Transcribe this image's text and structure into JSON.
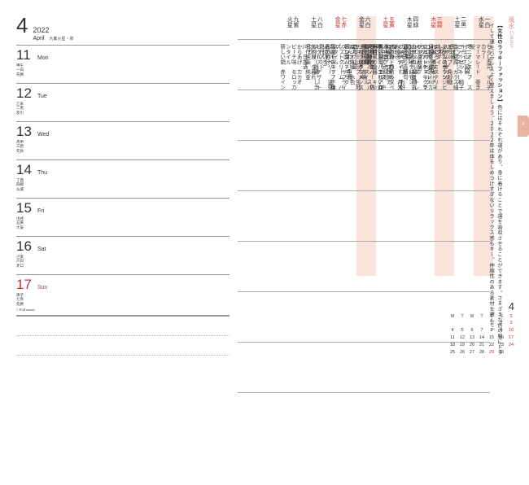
{
  "header": {
    "monthNum": "4",
    "year": "2022",
    "monthEn": "April",
    "monthJp": "九紫火星・卯"
  },
  "days": [
    {
      "num": "11",
      "dow": "Mon",
      "sub": "甲午\n一白\n先勝",
      "sun": false,
      "moon": ""
    },
    {
      "num": "12",
      "dow": "Tue",
      "sub": "乙未\n二黒\n友引",
      "sun": false,
      "moon": ""
    },
    {
      "num": "13",
      "dow": "Wed",
      "sub": "丙申\n三碧\n先負",
      "sun": false,
      "moon": ""
    },
    {
      "num": "14",
      "dow": "Thu",
      "sub": "丁酉\n四緑\n仏滅",
      "sun": false,
      "moon": ""
    },
    {
      "num": "15",
      "dow": "Fri",
      "sub": "戊戌\n五黄\n大安",
      "sun": false,
      "moon": ""
    },
    {
      "num": "16",
      "dow": "Sat",
      "sub": "己亥\n六白\n赤口",
      "sun": false,
      "moon": ""
    },
    {
      "num": "17",
      "dow": "Sun",
      "sub": "庚子\n七赤\n先勝",
      "sun": true,
      "moon": "○ Full moon"
    }
  ],
  "fusui": {
    "title": "風水",
    "sub": "Column"
  },
  "tab": "4",
  "columnText": {
    "bold": "【女性のラッキーファッション】",
    "rest": "色にはそれぞれ運があり、身に着けることで運を吸収させることができます。さまざまな色の服にトライして運をバランスよく整えましょう。２０２２年は体をしめつけすぎないリラックス感もキー。伸縮性のある素材を選んで。"
  },
  "stars": [
    {
      "t": "一白\n水星",
      "red": false
    },
    {
      "t": "二黒\n土星",
      "red": false
    },
    {
      "t": "三碧\n木星",
      "red": true
    },
    {
      "t": "四緑\n木星",
      "red": false
    },
    {
      "t": "五黄\n土星",
      "red": true
    },
    {
      "t": "六白\n金星",
      "red": false
    },
    {
      "t": "七赤\n金星",
      "red": true
    },
    {
      "t": "八白\n土星",
      "red": false
    },
    {
      "t": "九紫\n火星",
      "red": false
    }
  ],
  "table": [
    [
      "ちらし寿司\nマルチカラー",
      "オニオンスープ\nストライプ",
      "トランプ\n角砂糖",
      "ソーセージ\nイルカ",
      "エコ掃除\nレモン",
      "水の音\n感動の涙",
      "着物\n絵皿",
      "ラジオ体操\n水色",
      "ネットショップ\n指先ケア"
    ],
    [
      "マーマレード\n巻き髪",
      "ミックスジュース\n天球儀",
      "ホテルのラウンジ\nネクタイ",
      "ショートケーキ\nマザーズバッグ",
      "富士山\n高原",
      "浄水器\n流線形",
      "郷土料理\nタイル",
      "ギンガムチェック",
      "現代アート"
    ],
    [
      "デニム\n図解",
      "リボン\nデイジー（花）",
      "お粥\n積み木",
      "クラシカルな庭\n玄関掃除",
      "ミントティー\nバスマット",
      "黒い羽\nパエリア皿",
      "ヨガ\n塩ラーメン",
      "ソフトクリーム\nバスタイム",
      "スーパー銭湯\nしきたり"
    ],
    [
      "ティーセット\n椅子",
      "まぐろ\nミステリー",
      "ココナッツミルク\nうちわ",
      "カギモチーフ\nお好み焼き",
      "自撮り\nプラチナ",
      "南欧風の食器\nキッチン雑貨",
      "旅程\n山菜",
      "ブルーベリー\n温泉（せいろ）",
      "川\n日本酒"
    ],
    [
      "杏仁豆腐\nガラス細工",
      "烏龍茶\n麦茶",
      "メロンソーダ\nトレンドアイテム",
      "アボカドロール\nペチュニア",
      "シューズケース\n中央",
      "懐石料理\n古墳",
      "ふんわり\n重曹",
      "ピクルス\nデザート",
      "からあげ\nカカオ"
    ],
    [
      "マリンスポーツ\nビーズ",
      "カルパッチョ\nクラシック音楽",
      "おにぎり\n情句",
      "美容家電\nきれいな木目",
      "ヨットハーバー\n棉製の小物",
      "チューリップ\n生地店",
      "スコーン\nサプライズ",
      "美術展\nタ暮れ",
      "ピーチ味\nモロッカンタイル",
      "骨盤調整"
    ],
    [
      "ハム\nホワイトチョコ",
      "カヤック\n担々麺",
      "ミルクティー\n月光浴",
      "天然酵母パン\nスパイス",
      "ブックスタンド\nスニーカー",
      "四つ葉",
      "国産モチーフ\n不用品の処分",
      "名作映画\n純金",
      "新しい鍋\n赤ワイン"
    ]
  ],
  "minical": {
    "month": "4",
    "dow": [
      "M",
      "T",
      "W",
      "T",
      "F",
      "S",
      "S"
    ],
    "weeks": [
      [
        "",
        "",
        "",
        "",
        "1",
        "2",
        "3"
      ],
      [
        "4",
        "5",
        "6",
        "7",
        "8",
        "9",
        "10"
      ],
      [
        "11",
        "12",
        "13",
        "14",
        "15",
        "16",
        "17"
      ],
      [
        "18",
        "19",
        "20",
        "21",
        "22",
        "23",
        "24"
      ],
      [
        "25",
        "26",
        "27",
        "28",
        "29",
        "30",
        ""
      ]
    ],
    "redCells": [
      "3",
      "10",
      "17",
      "24",
      "29"
    ]
  }
}
